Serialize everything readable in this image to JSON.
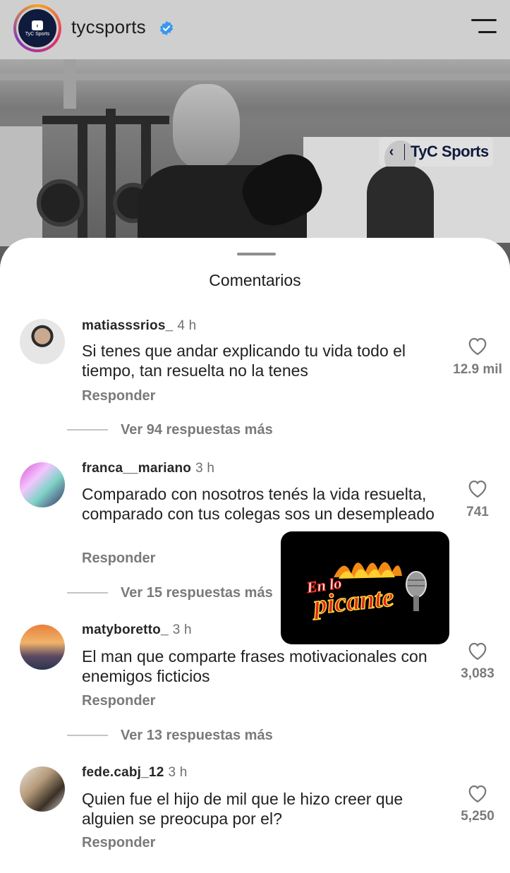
{
  "header": {
    "username": "tycsports",
    "avatar_text": "TyC Sports",
    "verified_icon": "verified-badge-icon",
    "menu_icon": "hamburger-menu-icon"
  },
  "photo": {
    "watermark": "TyC Sports"
  },
  "sheet": {
    "title": "Comentarios",
    "reply_label": "Responder"
  },
  "comments": [
    {
      "user": "matiasssrios_",
      "time": "4 h",
      "text": "Si tenes que andar explicando tu vida todo el tiempo, tan resuelta no la tenes",
      "likes": "12.9 mil",
      "more_replies": "Ver 94 respuestas más"
    },
    {
      "user": "franca__mariano",
      "time": "3 h",
      "text": "Comparado con nosotros tenés la vida resuelta, comparado con tus colegas sos un desempleado",
      "likes": "741",
      "more_replies": "Ver 15 respuestas más"
    },
    {
      "user": "matyboretto_",
      "time": "3 h",
      "text": "El man que comparte frases motivacionales con enemigos ficticios",
      "likes": "3,083",
      "more_replies": "Ver 13 respuestas más"
    },
    {
      "user": "fede.cabj_12",
      "time": "3 h",
      "text": "Quien fue el hijo de mil que le hizo creer que alguien se preocupa por el?",
      "likes": "5,250"
    }
  ],
  "overlay": {
    "logo_line1": "En lo",
    "logo_line2": "picante"
  },
  "colors": {
    "verified_blue": "#3897f0",
    "tyc_navy": "#0f1a3d",
    "overlay_red": "#d9261c"
  }
}
